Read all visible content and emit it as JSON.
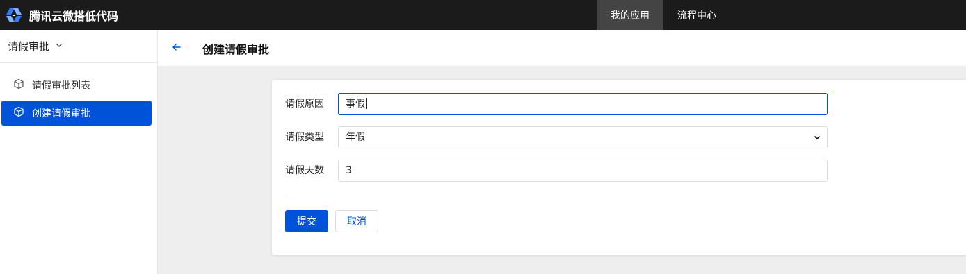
{
  "header": {
    "brand_name": "腾讯云微搭低代码",
    "nav": [
      {
        "label": "我的应用"
      },
      {
        "label": "流程中心"
      }
    ]
  },
  "sidebar": {
    "app_name": "请假审批",
    "menu": [
      {
        "label": "请假审批列表",
        "active": false
      },
      {
        "label": "创建请假审批",
        "active": true
      }
    ]
  },
  "page": {
    "title": "创建请假审批"
  },
  "form": {
    "fields": [
      {
        "label": "请假原因",
        "value": "事假"
      },
      {
        "label": "请假类型",
        "value": "年假"
      },
      {
        "label": "请假天数",
        "value": "3"
      }
    ],
    "submit_label": "提交",
    "cancel_label": "取消"
  },
  "colors": {
    "primary": "#0052d9",
    "topbar": "#1b1b1b",
    "content_bg": "#eeeeee"
  }
}
